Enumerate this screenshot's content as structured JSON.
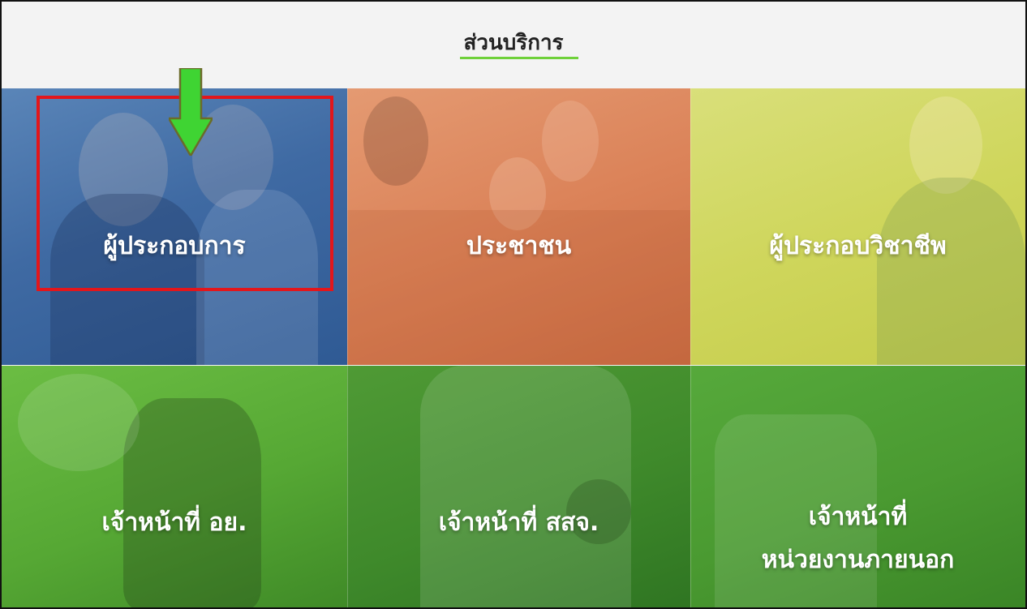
{
  "header": {
    "title": "ส่วนบริการ"
  },
  "tiles": [
    {
      "label_line1": "ผู้ประกอบการ",
      "label_line2": ""
    },
    {
      "label_line1": "ประชาชน",
      "label_line2": ""
    },
    {
      "label_line1": "ผู้ประกอบวิชาชีพ",
      "label_line2": ""
    },
    {
      "label_line1": "เจ้าหน้าที่ อย.",
      "label_line2": ""
    },
    {
      "label_line1": "เจ้าหน้าที่ สสจ.",
      "label_line2": ""
    },
    {
      "label_line1": "เจ้าหน้าที่",
      "label_line2": "หน่วยงานภายนอก"
    }
  ],
  "annotation": {
    "highlight_color": "#e3161b",
    "arrow_color": "#3fd433"
  },
  "colors": {
    "accent_underline": "#6fd13a",
    "tile_blue": "#3f6aa3",
    "tile_orange": "#db8258",
    "tile_yellow": "#cfd65c",
    "tile_green": "#56a834"
  }
}
